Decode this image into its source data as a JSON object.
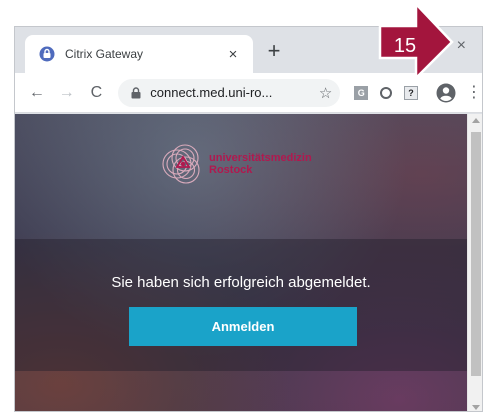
{
  "browser": {
    "tab": {
      "title": "Citrix Gateway",
      "close_label": "×",
      "favicon": "lock-favicon-icon"
    },
    "new_tab_label": "+",
    "window_close_label": "×",
    "toolbar": {
      "back_label": "←",
      "forward_label": "→",
      "reload_label": "C",
      "url": "connect.med.uni-ro...",
      "bookmark_label": "☆",
      "extensions": [
        {
          "name": "g-extension-icon",
          "label": "G"
        },
        {
          "name": "circle-extension-icon",
          "label": ""
        },
        {
          "name": "question-extension-icon",
          "label": "?"
        }
      ],
      "menu_label": "⋮"
    }
  },
  "page": {
    "logo": {
      "line1": "universitätsmedizin",
      "line2": "Rostock",
      "color": "#b0194f"
    },
    "logout_message": "Sie haben sich erfolgreich abgemeldet.",
    "login_button_label": "Anmelden",
    "accent_color": "#1aa3c9"
  },
  "annotation": {
    "step_number": "15",
    "color": "#a3153d"
  }
}
